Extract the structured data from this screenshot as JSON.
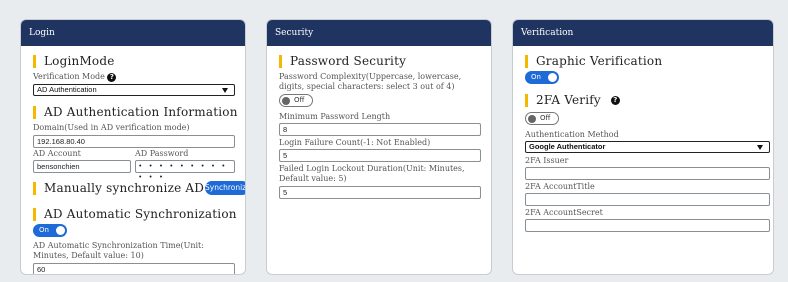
{
  "login": {
    "header": "Login",
    "login_mode_title": "LoginMode",
    "verification_mode_label": "Verification Mode",
    "verification_mode_value": "AD Authentication",
    "ad_auth_title": "AD Authentication Information",
    "domain_label": "Domain(Used in AD verification mode)",
    "domain_value": "192.168.80.40",
    "ad_account_label": "AD Account",
    "ad_account_value": "bensonchien",
    "ad_password_label": "AD Password",
    "ad_password_value": "• • • • • • • • • • • •",
    "manual_sync_title": "Manually synchronize AD",
    "sync_button": "Synchronize",
    "auto_sync_title": "AD Automatic Synchronization",
    "auto_sync_toggle": "On",
    "auto_sync_time_label": "AD Automatic Synchronization Time(Unit: Minutes, Default value: 10)",
    "auto_sync_time_value": "60"
  },
  "security": {
    "header": "Security",
    "password_security_title": "Password Security",
    "complexity_label": "Password Complexity(Uppercase, lowercase, digits, special characters: select 3 out of 4)",
    "complexity_toggle": "Off",
    "min_length_label": "Minimum Password Length",
    "min_length_value": "8",
    "failure_count_label": "Login Failure Count(-1: Not Enabled)",
    "failure_count_value": "5",
    "lockout_label": "Failed Login Lockout Duration(Unit: Minutes, Default value: 5)",
    "lockout_value": "5"
  },
  "verification": {
    "header": "Verification",
    "graphic_title": "Graphic Verification",
    "graphic_toggle": "On",
    "twofa_title": "2FA Verify",
    "twofa_toggle": "Off",
    "auth_method_label": "Authentication Method",
    "auth_method_value": "Google Authenticator",
    "issuer_label": "2FA Issuer",
    "issuer_value": "",
    "account_title_label": "2FA AccountTitle",
    "account_title_value": "",
    "account_secret_label": "2FA AccountSecret",
    "account_secret_value": ""
  },
  "icons": {
    "help": "?"
  },
  "colors": {
    "header_bg": "#1f3461",
    "accent_bar": "#f5b800",
    "toggle_on": "#1e6ad6"
  }
}
